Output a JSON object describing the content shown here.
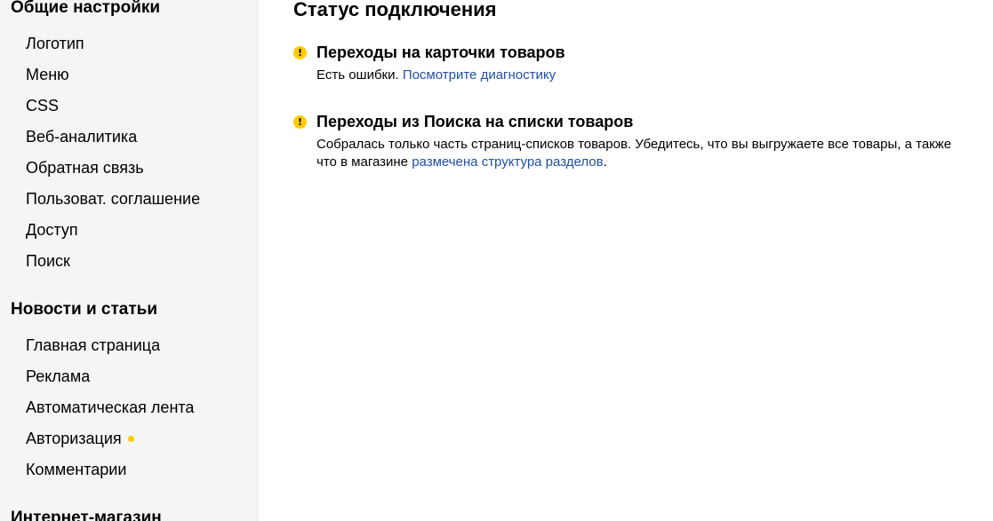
{
  "colors": {
    "sidebar_bg": "#f5f5f5",
    "link": "#1f4fa8",
    "warning": "#ffcc00",
    "dot": "#ffcc00"
  },
  "sidebar": {
    "sections": [
      {
        "title": "Общие настройки",
        "items": [
          {
            "label": "Логотип"
          },
          {
            "label": "Меню"
          },
          {
            "label": "CSS"
          },
          {
            "label": "Веб-аналитика"
          },
          {
            "label": "Обратная связь"
          },
          {
            "label": "Пользоват. соглашение"
          },
          {
            "label": "Доступ"
          },
          {
            "label": "Поиск"
          }
        ]
      },
      {
        "title": "Новости и статьи",
        "items": [
          {
            "label": "Главная страница"
          },
          {
            "label": "Реклама"
          },
          {
            "label": "Автоматическая лента"
          },
          {
            "label": "Авторизация",
            "badge": "warning-dot"
          },
          {
            "label": "Комментарии"
          }
        ]
      },
      {
        "title": "Интернет-магазин",
        "items": []
      }
    ]
  },
  "main": {
    "title": "Статус подключения",
    "statuses": [
      {
        "icon": "warning-icon",
        "title": "Переходы на карточки товаров",
        "desc_prefix": "Есть ошибки. ",
        "link_text": "Посмотрите диагностику",
        "desc_suffix": ""
      },
      {
        "icon": "warning-icon",
        "title": "Переходы из Поиска на списки товаров",
        "desc_prefix": "Собралась только часть страниц-списков товаров. Убедитесь, что вы выгружаете все товары, а также что в магазине ",
        "link_text": "размечена структура разделов",
        "desc_suffix": "."
      }
    ]
  }
}
